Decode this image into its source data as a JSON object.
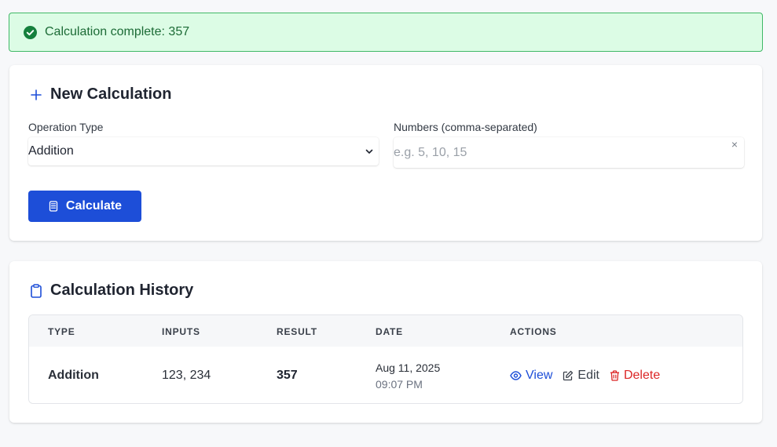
{
  "alert": {
    "message": "Calculation complete: 357",
    "color": "#40b866"
  },
  "new_calc": {
    "title": "New Calculation",
    "operation_label": "Operation Type",
    "operation_value": "Addition",
    "numbers_label": "Numbers (comma-separated)",
    "numbers_placeholder": "e.g. 5, 10, 15",
    "numbers_value": "",
    "clear_symbol": "×",
    "calculate_label": "Calculate",
    "accent": "#1d4ed8"
  },
  "history": {
    "title": "Calculation History",
    "columns": [
      "TYPE",
      "INPUTS",
      "RESULT",
      "DATE",
      "ACTIONS"
    ],
    "rows": [
      {
        "type": "Addition",
        "inputs": "123, 234",
        "result": "357",
        "date": "Aug 11, 2025",
        "time": "09:07 PM",
        "view_label": "View",
        "edit_label": "Edit",
        "delete_label": "Delete"
      }
    ]
  },
  "icons": {
    "alert": "check-circle-icon",
    "new_calc": "plus-icon",
    "calculate": "calculator-icon",
    "history": "clipboard-icon",
    "view": "eye-icon",
    "edit": "edit-icon",
    "delete": "trash-icon",
    "select": "chevron-down-icon"
  }
}
